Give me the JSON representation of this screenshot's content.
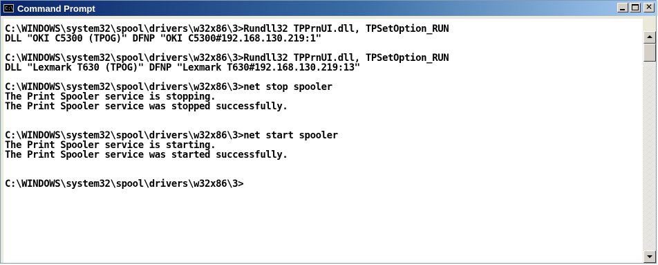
{
  "window": {
    "title": "Command Prompt",
    "icon": "cmd-icon",
    "icon_text": "C:\\"
  },
  "console": {
    "lines": [
      "C:\\WINDOWS\\system32\\spool\\drivers\\w32x86\\3>Rundll32 TPPrnUI.dll, TPSetOption_RUN",
      "DLL \"OKI C5300 (TPOG)\" DFNP \"OKI C5300#192.168.130.219:1\"",
      "",
      "C:\\WINDOWS\\system32\\spool\\drivers\\w32x86\\3>Rundll32 TPPrnUI.dll, TPSetOption_RUN",
      "DLL \"Lexmark T630 (TPOG)\" DFNP \"Lexmark T630#192.168.130.219:13\"",
      "",
      "C:\\WINDOWS\\system32\\spool\\drivers\\w32x86\\3>net stop spooler",
      "The Print Spooler service is stopping.",
      "The Print Spooler service was stopped successfully.",
      "",
      "",
      "C:\\WINDOWS\\system32\\spool\\drivers\\w32x86\\3>net start spooler",
      "The Print Spooler service is starting.",
      "The Print Spooler service was started successfully.",
      "",
      "",
      "C:\\WINDOWS\\system32\\spool\\drivers\\w32x86\\3>"
    ]
  },
  "colors": {
    "title_bar_start": "#0a246a",
    "title_bar_end": "#a6caf0",
    "console_bg": "#ffffff",
    "console_text": "#000000"
  }
}
